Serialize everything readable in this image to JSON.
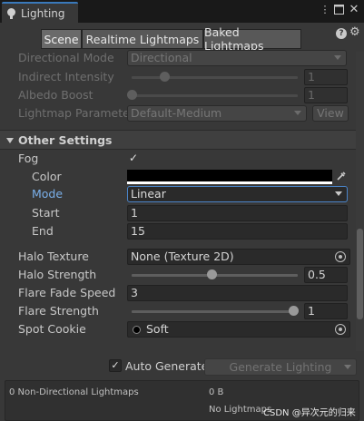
{
  "window": {
    "tab_title": "Lighting",
    "menu_icon": "kebab-menu-icon",
    "maximize_icon": "maximize-icon",
    "close_icon": "close-icon"
  },
  "toolbar": {
    "tabs": [
      "Scene",
      "Realtime Lightmaps",
      "Baked Lightmaps"
    ],
    "active_tab": "Scene",
    "help_icon": "help-icon",
    "settings_icon": "gear-icon"
  },
  "lightmapping": {
    "directional_mode": {
      "label": "Directional Mode",
      "value": "Directional"
    },
    "indirect_intensity": {
      "label": "Indirect Intensity",
      "value": "1",
      "slider": 0.2
    },
    "albedo_boost": {
      "label": "Albedo Boost",
      "value": "1",
      "slider": 0.0
    },
    "lightmap_parameters": {
      "label": "Lightmap Parameters",
      "value": "Default-Medium",
      "view_label": "View"
    }
  },
  "other_settings": {
    "header": "Other Settings",
    "fog": {
      "label": "Fog",
      "checked": true,
      "check_glyph": "✓"
    },
    "color": {
      "label": "Color",
      "value": "#000000"
    },
    "mode": {
      "label": "Mode",
      "value": "Linear"
    },
    "start": {
      "label": "Start",
      "value": "1"
    },
    "end": {
      "label": "End",
      "value": "15"
    },
    "halo_texture": {
      "label": "Halo Texture",
      "value": "None (Texture 2D)"
    },
    "halo_strength": {
      "label": "Halo Strength",
      "value": "0.5",
      "slider": 0.5
    },
    "flare_fade_speed": {
      "label": "Flare Fade Speed",
      "value": "3"
    },
    "flare_strength": {
      "label": "Flare Strength",
      "value": "1",
      "slider": 1.0
    },
    "spot_cookie": {
      "label": "Spot Cookie",
      "value": "Soft"
    }
  },
  "footer": {
    "auto_generate": {
      "label": "Auto Generate",
      "checked": true,
      "check_glyph": "✓"
    },
    "generate_button": "Generate Lighting",
    "stats": {
      "lightmaps": "0 Non-Directional Lightmaps",
      "size": "0 B",
      "no_lightmaps": "No Lightmaps"
    },
    "watermark": "CSDN @异次元的归来"
  },
  "colors": {
    "accent": "#3a79bb",
    "focus_border": "#4a84c9",
    "active_label": "#7ab0ea"
  }
}
